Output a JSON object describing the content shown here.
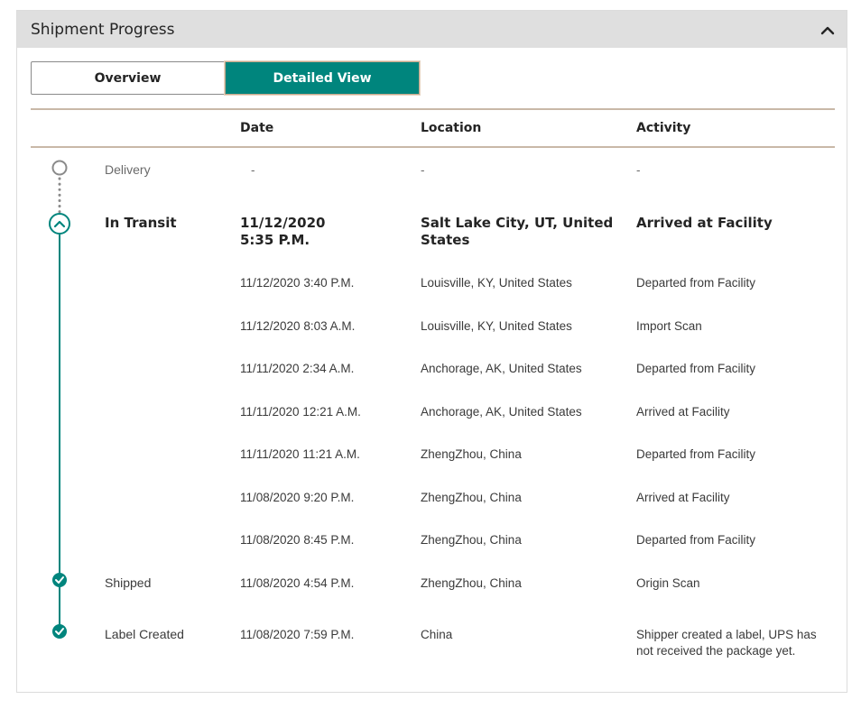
{
  "panel": {
    "title": "Shipment Progress",
    "collapse_icon": "chevron-up-icon"
  },
  "tabs": [
    {
      "label": "Overview",
      "selected": false
    },
    {
      "label": "Detailed View",
      "selected": true
    }
  ],
  "columns": {
    "date": "Date",
    "location": "Location",
    "activity": "Activity"
  },
  "colors": {
    "accent": "#00857d",
    "pending": "#8a8a8a",
    "header_bg": "#dfdfdf",
    "rule": "#c9b8a8"
  },
  "milestones": [
    {
      "status": "Delivery",
      "state": "pending",
      "date": "-",
      "location": "-",
      "activity": "-"
    },
    {
      "status": "In Transit",
      "state": "current",
      "date_line1": "11/12/2020",
      "date_line2": "5:35 P.M.",
      "location_line1": "Salt Lake City, UT, United",
      "location_line2": "States",
      "activity": "Arrived at Facility"
    },
    {
      "status": "Shipped",
      "state": "complete",
      "date": "11/08/2020  4:54 P.M.",
      "location": "ZhengZhou, China",
      "activity": "Origin Scan"
    },
    {
      "status": "Label Created",
      "state": "complete",
      "date": "11/08/2020  7:59 P.M.",
      "location": "China",
      "activity_line1": "Shipper created a label, UPS has",
      "activity_line2": "not received the package yet."
    }
  ],
  "events": [
    {
      "date": "11/12/2020  3:40 P.M.",
      "location": "Louisville, KY, United States",
      "activity": "Departed from Facility"
    },
    {
      "date": "11/12/2020  8:03 A.M.",
      "location": "Louisville, KY, United States",
      "activity": "Import Scan"
    },
    {
      "date": "11/11/2020  2:34 A.M.",
      "location": "Anchorage, AK, United States",
      "activity": "Departed from Facility"
    },
    {
      "date": "11/11/2020  12:21 A.M.",
      "location": "Anchorage, AK, United States",
      "activity": "Arrived at Facility"
    },
    {
      "date": "11/11/2020  11:21 A.M.",
      "location": "ZhengZhou, China",
      "activity": "Departed from Facility"
    },
    {
      "date": "11/08/2020  9:20 P.M.",
      "location": "ZhengZhou, China",
      "activity": "Arrived at Facility"
    },
    {
      "date": "11/08/2020  8:45 P.M.",
      "location": "ZhengZhou, China",
      "activity": "Departed from Facility"
    }
  ]
}
